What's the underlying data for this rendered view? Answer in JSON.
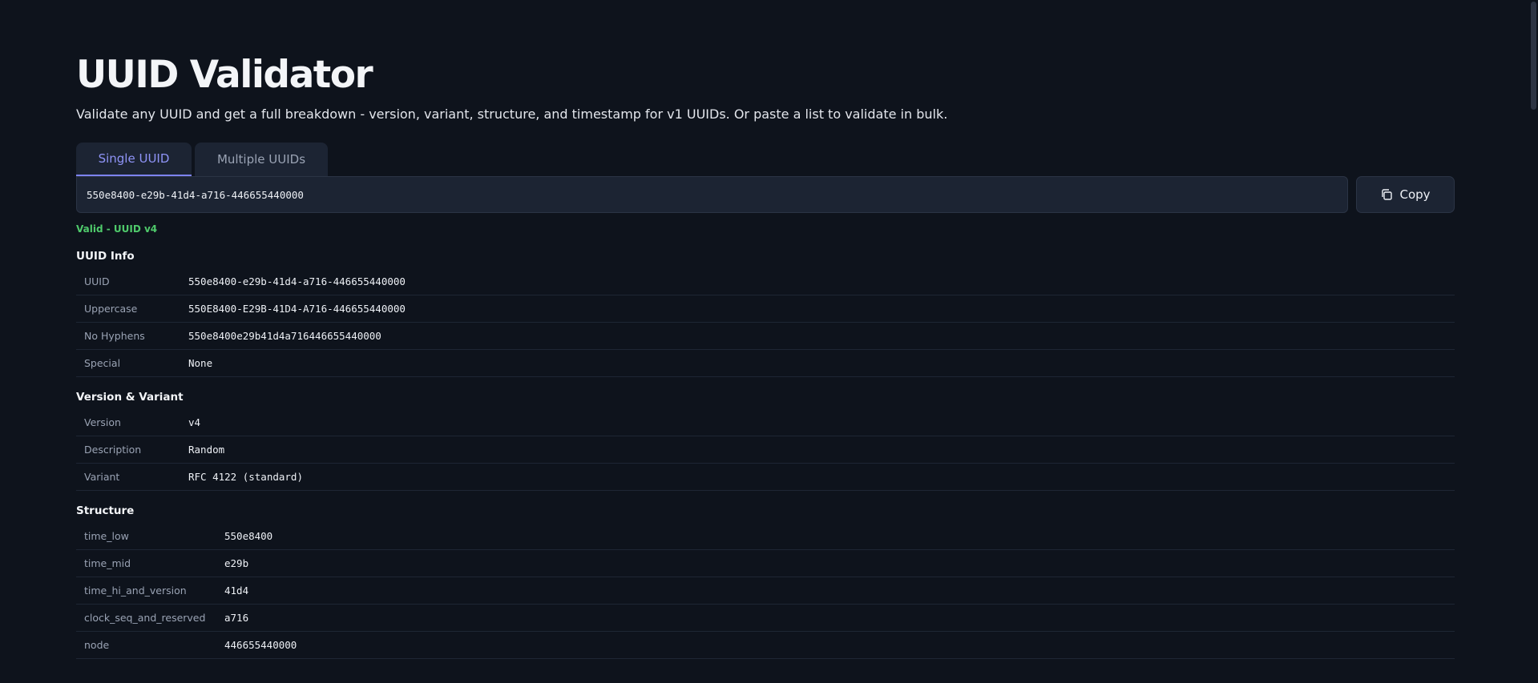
{
  "header": {
    "title": "UUID Validator",
    "subtitle": "Validate any UUID and get a full breakdown - version, variant, structure, and timestamp for v1 UUIDs. Or paste a list to validate in bulk."
  },
  "tabs": [
    {
      "label": "Single UUID",
      "active": true
    },
    {
      "label": "Multiple UUIDs",
      "active": false
    }
  ],
  "input": {
    "value": "550e8400-e29b-41d4-a716-446655440000"
  },
  "copy_button": {
    "label": "Copy",
    "icon": "copy-icon"
  },
  "status": {
    "text": "Valid - UUID v4",
    "color": "#4fca6b"
  },
  "sections": {
    "info": {
      "title": "UUID Info",
      "rows": [
        {
          "key": "UUID",
          "value": "550e8400-e29b-41d4-a716-446655440000"
        },
        {
          "key": "Uppercase",
          "value": "550E8400-E29B-41D4-A716-446655440000"
        },
        {
          "key": "No Hyphens",
          "value": "550e8400e29b41d4a716446655440000"
        },
        {
          "key": "Special",
          "value": "None"
        }
      ]
    },
    "version": {
      "title": "Version & Variant",
      "rows": [
        {
          "key": "Version",
          "value": "v4"
        },
        {
          "key": "Description",
          "value": "Random"
        },
        {
          "key": "Variant",
          "value": "RFC 4122 (standard)"
        }
      ]
    },
    "structure": {
      "title": "Structure",
      "rows": [
        {
          "key": "time_low",
          "value": "550e8400"
        },
        {
          "key": "time_mid",
          "value": "e29b"
        },
        {
          "key": "time_hi_and_version",
          "value": "41d4"
        },
        {
          "key": "clock_seq_and_reserved",
          "value": "a716"
        },
        {
          "key": "node",
          "value": "446655440000"
        }
      ]
    }
  },
  "colors": {
    "background": "#0e131c",
    "accent": "#8f94f7",
    "valid": "#4fca6b"
  }
}
